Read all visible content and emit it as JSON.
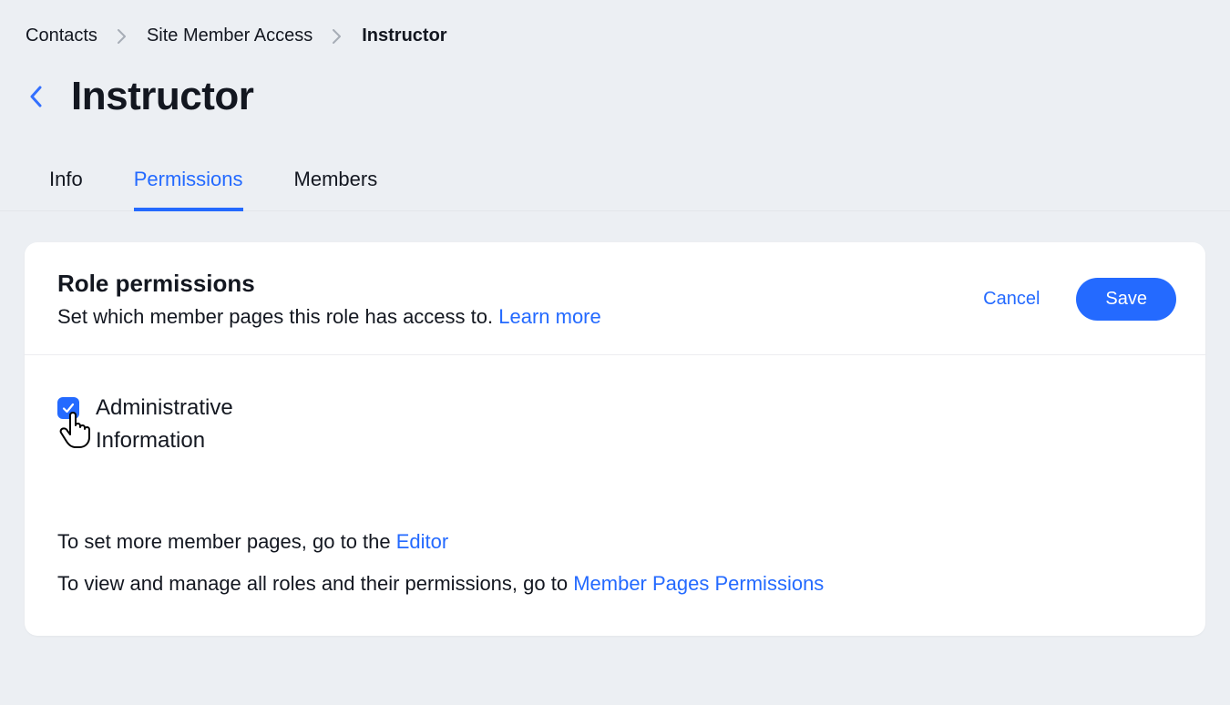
{
  "breadcrumb": {
    "items": [
      "Contacts",
      "Site Member Access"
    ],
    "current": "Instructor"
  },
  "header": {
    "title": "Instructor"
  },
  "tabs": {
    "items": [
      {
        "label": "Info"
      },
      {
        "label": "Permissions"
      },
      {
        "label": "Members"
      }
    ]
  },
  "card": {
    "title": "Role permissions",
    "subtitle_prefix": "Set which member pages this role has access to. ",
    "learn_more": "Learn more",
    "cancel": "Cancel",
    "save": "Save"
  },
  "permissions": {
    "item1": "Administrative Information"
  },
  "info": {
    "line1_prefix": "To set more member pages, go to the ",
    "line1_link": "Editor",
    "line2_prefix": "To view and manage all roles and their permissions, go to ",
    "line2_link": "Member Pages Permissions"
  }
}
